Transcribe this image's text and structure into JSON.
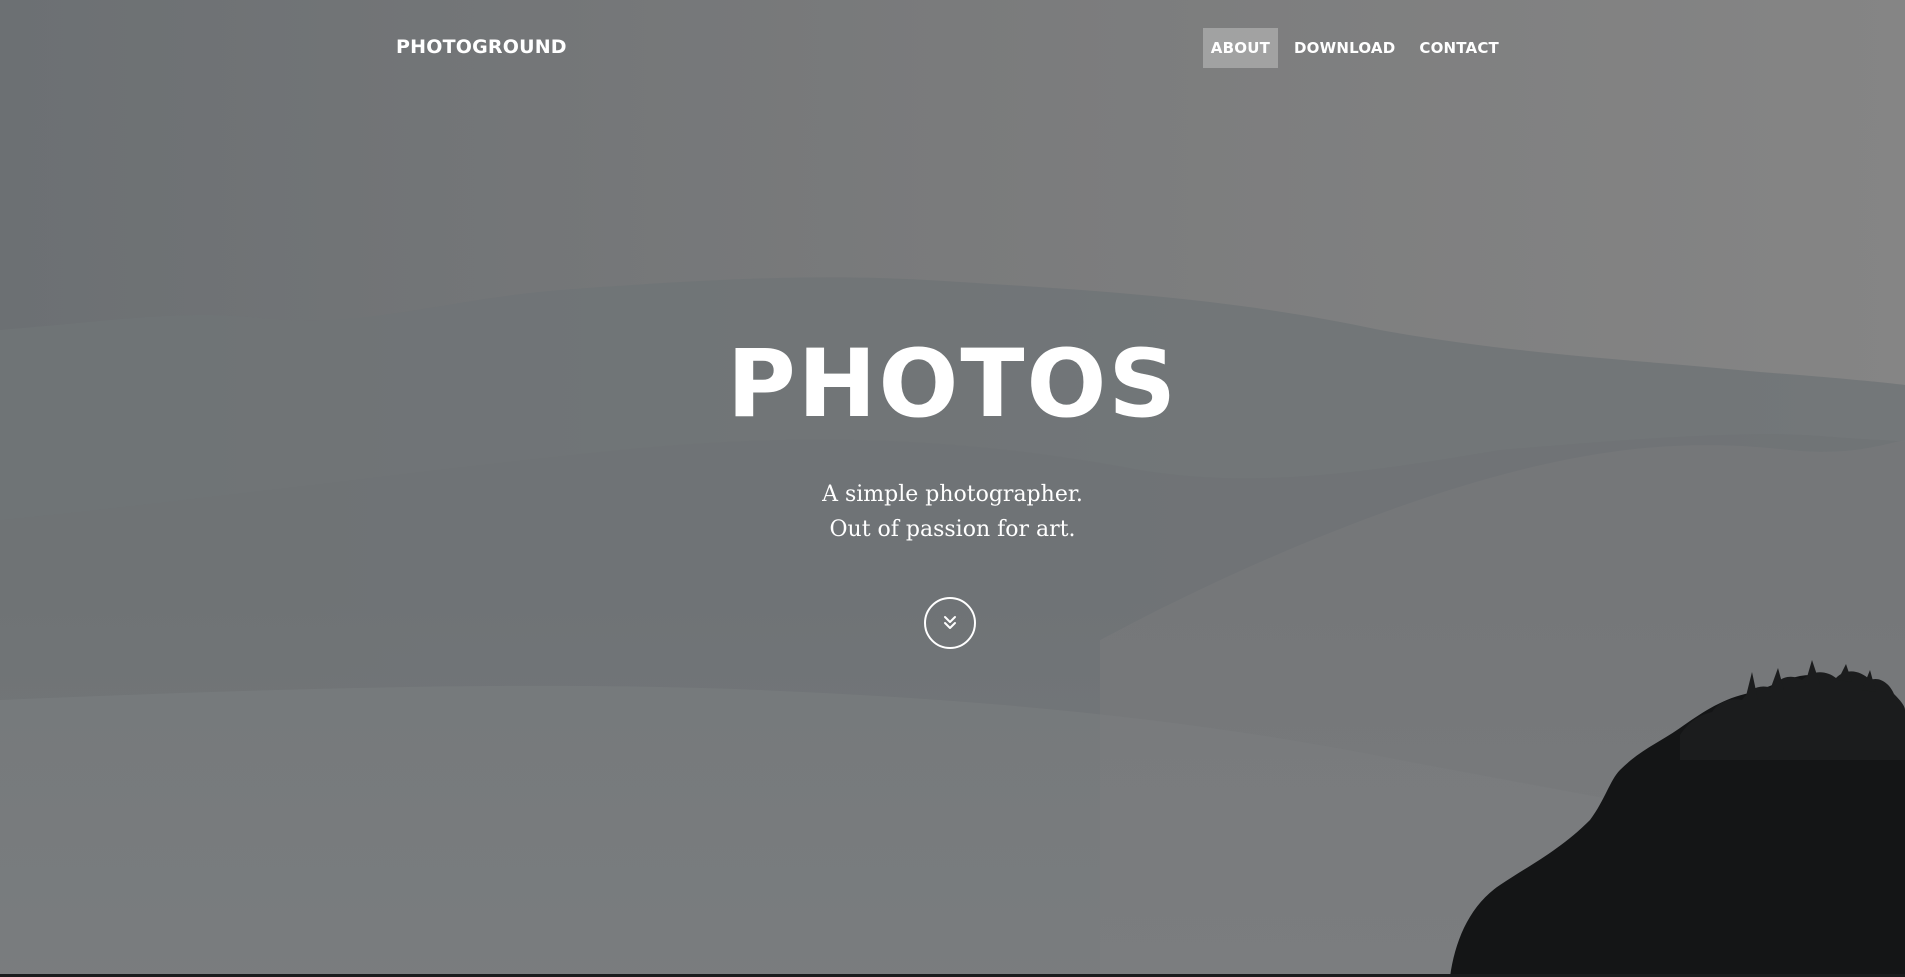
{
  "navbar": {
    "brand": "PHOTOGROUND",
    "links": [
      {
        "label": "ABOUT",
        "active": true
      },
      {
        "label": "DOWNLOAD",
        "active": false
      },
      {
        "label": "CONTACT",
        "active": false
      }
    ]
  },
  "hero": {
    "title": "PHOTOS",
    "subtitle_lines": [
      "A simple photographer.",
      "Out of passion for art."
    ],
    "scroll_icon": "double-chevron-down-icon"
  },
  "colors": {
    "text": "#ffffff",
    "active_nav_bg": "rgba(255,255,255,0.28)",
    "overlay": "#6f7376"
  }
}
